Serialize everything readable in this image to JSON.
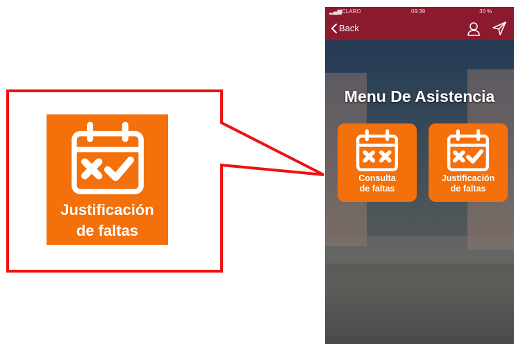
{
  "status_bar": {
    "carrier": "CLARO",
    "time": "09:39",
    "battery": "30 %"
  },
  "nav": {
    "back_label": "Back",
    "profile_icon": "user-icon",
    "send_icon": "send-icon",
    "bar_color": "#8b1a2e"
  },
  "menu": {
    "title": "Menu De Asistencia",
    "tiles": [
      {
        "line1": "Consulta",
        "line2": "de faltas",
        "icon": "calendar-xx-icon"
      },
      {
        "line1": "Justificación",
        "line2": "de faltas",
        "icon": "calendar-x-check-icon"
      }
    ],
    "accent": "#f3700a"
  },
  "callout": {
    "line1": "Justificación",
    "line2": "de faltas",
    "icon": "calendar-x-check-icon",
    "border_color": "#ee1111"
  }
}
